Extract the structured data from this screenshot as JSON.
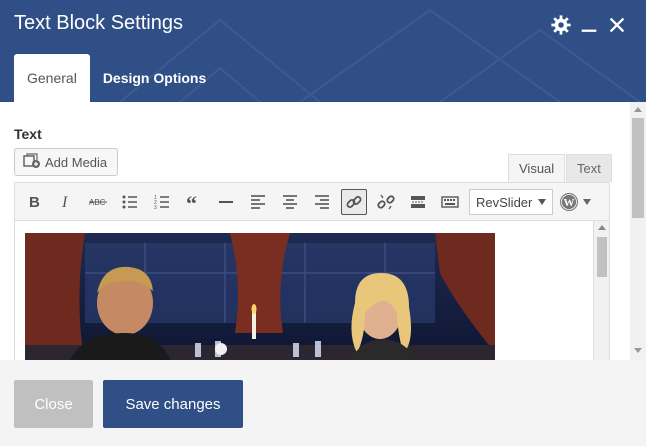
{
  "dialog": {
    "title": "Text Block Settings",
    "icons": {
      "settings": "gear-icon",
      "minimize": "minimize-icon",
      "close": "close-icon"
    }
  },
  "tabs": [
    {
      "label": "General",
      "active": true
    },
    {
      "label": "Design Options",
      "active": false
    }
  ],
  "field": {
    "label": "Text"
  },
  "add_media": {
    "label": "Add Media",
    "icon": "add-media-icon"
  },
  "editor_modes": {
    "visual": "Visual",
    "text": "Text"
  },
  "toolbar": {
    "buttons": [
      "bold",
      "italic",
      "strikethrough",
      "bullet-list",
      "numbered-list",
      "blockquote",
      "horizontal-line",
      "align-left",
      "align-center",
      "align-right",
      "insert-link",
      "remove-link",
      "read-more",
      "toolbar-toggle"
    ],
    "active_button": "insert-link",
    "select": {
      "value": "RevSlider"
    },
    "wp_menu": "wordpress-icon"
  },
  "footer": {
    "close_label": "Close",
    "save_label": "Save changes"
  },
  "colors": {
    "header": "#2f4f86",
    "primary": "#2f4f86",
    "close_button": "#c0c0c0"
  }
}
